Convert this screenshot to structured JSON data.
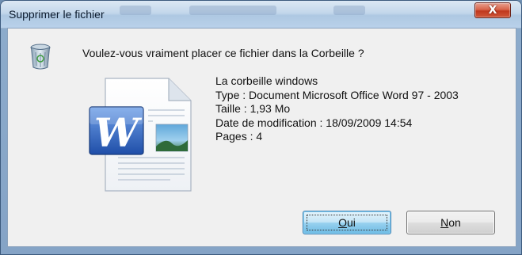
{
  "window": {
    "title": "Supprimer le fichier",
    "close_label": "X"
  },
  "dialog": {
    "question": "Voulez-vous vraiment placer ce fichier dans la Corbeille ?",
    "file": {
      "name": "La corbeille windows",
      "type": "Type : Document Microsoft Office Word 97 - 2003",
      "size": "Taille : 1,93 Mo",
      "modified": "Date de modification : 18/09/2009 14:54",
      "pages": "Pages : 4"
    },
    "icons": {
      "header": "recycle-bin-icon",
      "file": "word-document-icon"
    }
  },
  "buttons": {
    "yes": {
      "mnemonic": "O",
      "rest": "ui"
    },
    "no": {
      "mnemonic": "N",
      "rest": "on"
    }
  },
  "colors": {
    "accent": "#3c7fb1",
    "close": "#c0381e",
    "word_blue": "#2b5fb8"
  }
}
